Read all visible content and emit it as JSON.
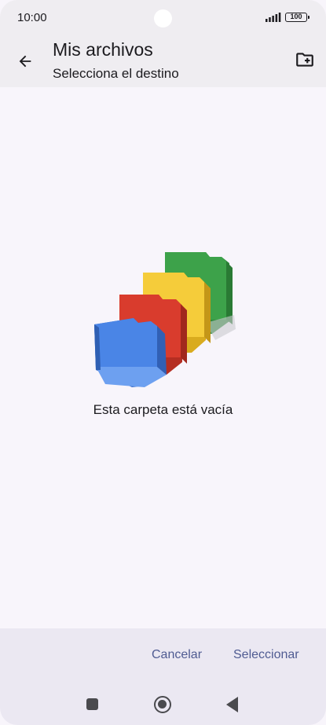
{
  "status_bar": {
    "time": "10:00",
    "battery": "100",
    "icons": [
      "signal-icon",
      "battery-icon"
    ]
  },
  "app_bar": {
    "title": "Mis archivos",
    "subtitle": "Selecciona el destino",
    "back_icon": "arrow-back-icon",
    "new_folder_icon": "create-new-folder-icon"
  },
  "content": {
    "empty_message": "Esta carpeta está vacía",
    "illustration": "empty-folders-illustration"
  },
  "actions": {
    "cancel_label": "Cancelar",
    "select_label": "Seleccionar"
  },
  "nav_bar": {
    "icons": [
      "recents-icon",
      "home-icon",
      "back-icon"
    ]
  },
  "colors": {
    "app_bar_bg": "#efedf1",
    "content_bg": "#f8f5fb",
    "action_bar_bg": "#ebe8f2",
    "accent": "#4f5b92",
    "folder_blue": "#4a85e6",
    "folder_red": "#d33b2c",
    "folder_yellow": "#f2c62f",
    "folder_green": "#3b9c46"
  }
}
